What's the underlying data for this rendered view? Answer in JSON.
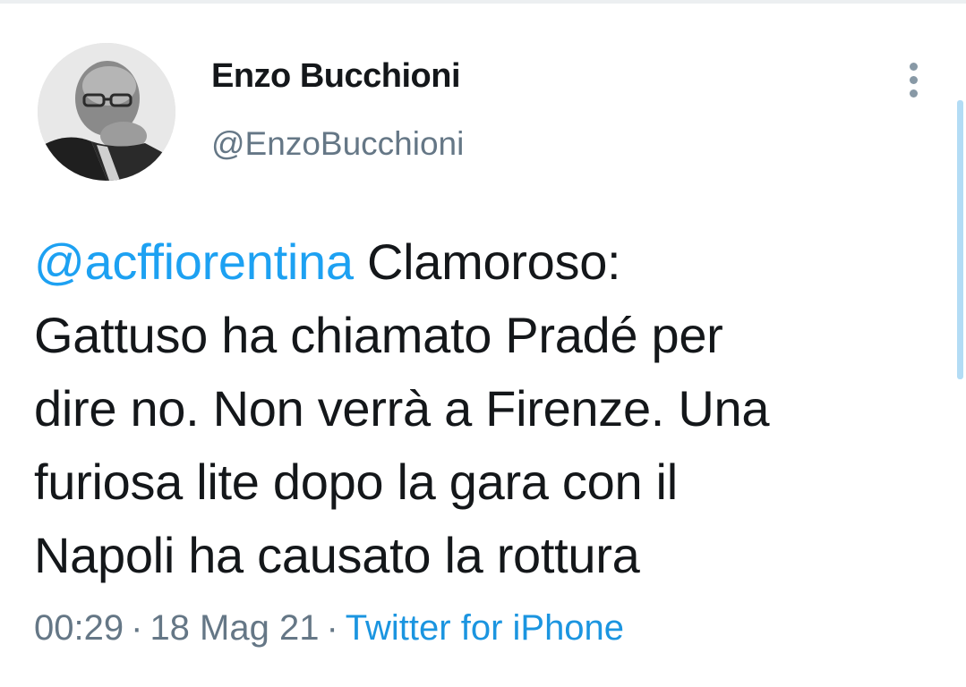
{
  "tweet": {
    "author": {
      "display_name": "Enzo Bucchioni",
      "handle": "@EnzoBucchioni",
      "avatar_icon": "profile-photo"
    },
    "more_icon": "more-vertical-icon",
    "mention": "@acffiorentina",
    "text_line1_rest": " Clamoroso:",
    "text_line2": "Gattuso ha chiamato Pradé per",
    "text_line3": "dire no. Non verrà a Firenze. Una",
    "text_line4": "furiosa lite dopo la gara con il",
    "text_line5": "Napoli ha causato la rottura",
    "time": "00:29",
    "separator": "·",
    "date": "18 Mag 21",
    "source": "Twitter for iPhone"
  },
  "colors": {
    "text": "#14171a",
    "secondary": "#657786",
    "link": "#1da1f2",
    "scrollbar": "#b3dcf5"
  }
}
